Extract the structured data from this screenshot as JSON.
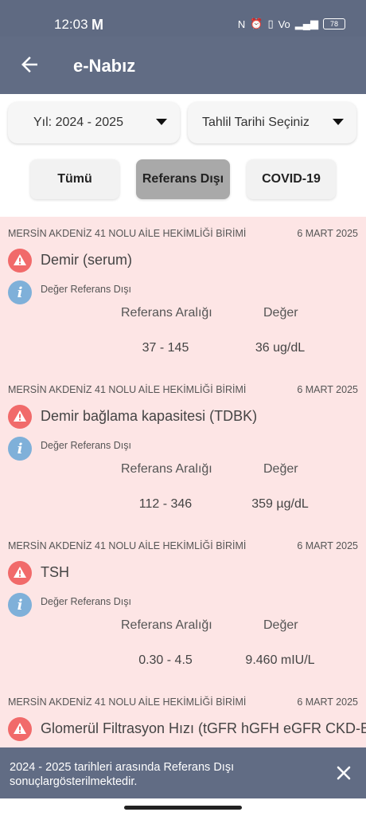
{
  "status_bar": {
    "time": "12:03",
    "app_glyph": "M",
    "icons": [
      "nfc-icon",
      "alarm-icon",
      "vibrate-icon",
      "volte-icon",
      "signal-icon"
    ],
    "battery": "78"
  },
  "app_bar": {
    "back_icon": "arrow-left-icon",
    "title": "e-Nabız",
    "color": "#616c84"
  },
  "filters": {
    "year_dropdown": "Yıl: 2024 - 2025",
    "date_dropdown": "Tahlil Tarihi Seçiniz"
  },
  "tabs": [
    {
      "label": "Tümü",
      "selected": false
    },
    {
      "label": "Referans Dışı",
      "selected": true
    },
    {
      "label": "COVID-19",
      "selected": false
    }
  ],
  "results": [
    {
      "clinic": "MERSİN AKDENİZ 41 NOLU AİLE HEKİMLİĞİ BİRİMİ",
      "date": "6 MART 2025",
      "test": "Demir (serum)",
      "note": "Değer Referans Dışı",
      "range_header": "Referans Aralığı",
      "value_header": "Değer",
      "range": "37 - 145",
      "value": "36 ug/dL"
    },
    {
      "clinic": "MERSİN AKDENİZ 41 NOLU AİLE HEKİMLİĞİ BİRİMİ",
      "date": "6 MART 2025",
      "test": "Demir bağlama kapasitesi (TDBK)",
      "note": "Değer Referans Dışı",
      "range_header": "Referans Aralığı",
      "value_header": "Değer",
      "range": "112 - 346",
      "value": "359 µg/dL"
    },
    {
      "clinic": "MERSİN AKDENİZ 41 NOLU AİLE HEKİMLİĞİ BİRİMİ",
      "date": "6 MART 2025",
      "test": "TSH",
      "note": "Değer Referans Dışı",
      "range_header": "Referans Aralığı",
      "value_header": "Değer",
      "range": "0.30 - 4.5",
      "value": "9.460 mIU/L"
    },
    {
      "clinic": "MERSİN AKDENİZ 41 NOLU AİLE HEKİMLİĞİ BİRİMİ",
      "date": "6 MART 2025",
      "test": "Glomerül Filtrasyon Hızı (tGFR hGFH eGFR CKD-EPI)"
    }
  ],
  "colors": {
    "results_background": "#fde5e5",
    "warning": "#f16a6a",
    "info": "#7fb0d9",
    "selected_tab": "#a9a9a9"
  },
  "snackbar": {
    "message": "2024 - 2025 tarihleri arasında Referans Dışı sonuçlargösterilmektedir.",
    "close_icon": "close-icon"
  }
}
